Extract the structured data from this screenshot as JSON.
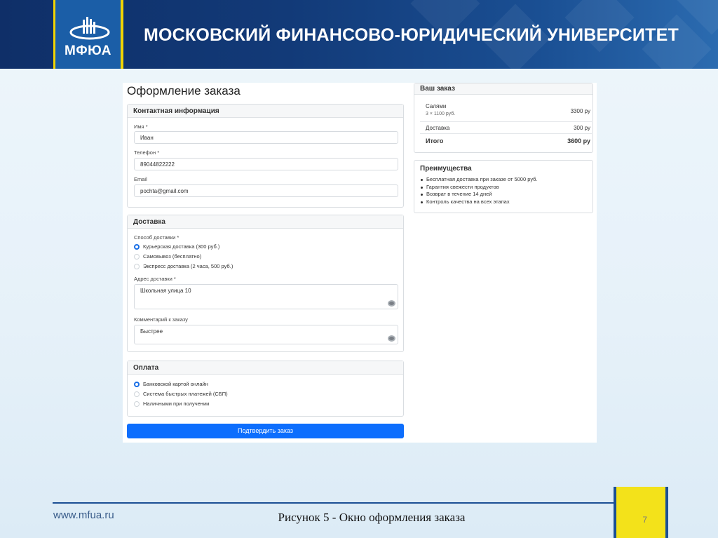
{
  "header": {
    "logo_text": "МФЮА",
    "university_title": "МОСКОВСКИЙ ФИНАНСОВО-ЮРИДИЧЕСКИЙ УНИВЕРСИТЕТ"
  },
  "checkout": {
    "page_title": "Оформление заказа",
    "contact": {
      "heading": "Контактная информация",
      "name_label": "Имя *",
      "name_value": "Иван",
      "phone_label": "Телефон *",
      "phone_value": "89044822222",
      "email_label": "Email",
      "email_value": "pochta@gmail.com"
    },
    "delivery": {
      "heading": "Доставка",
      "method_label": "Способ доставки *",
      "options": [
        "Курьерская доставка (300 руб.)",
        "Самовывоз (бесплатно)",
        "Экспресс доставка (2 часа, 500 руб.)"
      ],
      "selected_index": 0,
      "address_label": "Адрес доставки *",
      "address_value": "Школьная улица 10",
      "comment_label": "Комментарий к заказу",
      "comment_value": "Быстрее"
    },
    "payment": {
      "heading": "Оплата",
      "options": [
        "Банковской картой онлайн",
        "Система быстрых платежей (СБП)",
        "Наличными при получении"
      ],
      "selected_index": 0
    },
    "submit_label": "Подтвердить заказ",
    "order": {
      "heading": "Ваш заказ",
      "item_name": "Салями",
      "item_detail": "3 × 1100 руб.",
      "item_price": "3300 ру",
      "delivery_label": "Доставка",
      "delivery_price": "300 ру",
      "total_label": "Итого",
      "total_price": "3600 ру"
    },
    "benefits": {
      "heading": "Преимущества",
      "items": [
        "Бесплатная доставка при заказе от 5000 руб.",
        "Гарантия свежести продуктов",
        "Возврат в течение 14 дней",
        "Контроль качества на всех этапах"
      ]
    }
  },
  "footer": {
    "site": "www.mfua.ru",
    "caption": "Рисунок 5 - Окно оформления заказа",
    "page_number": "7"
  },
  "colors": {
    "header_bg": "#123a78",
    "accent_yellow": "#f2d400",
    "primary_button": "#0d6efd"
  }
}
